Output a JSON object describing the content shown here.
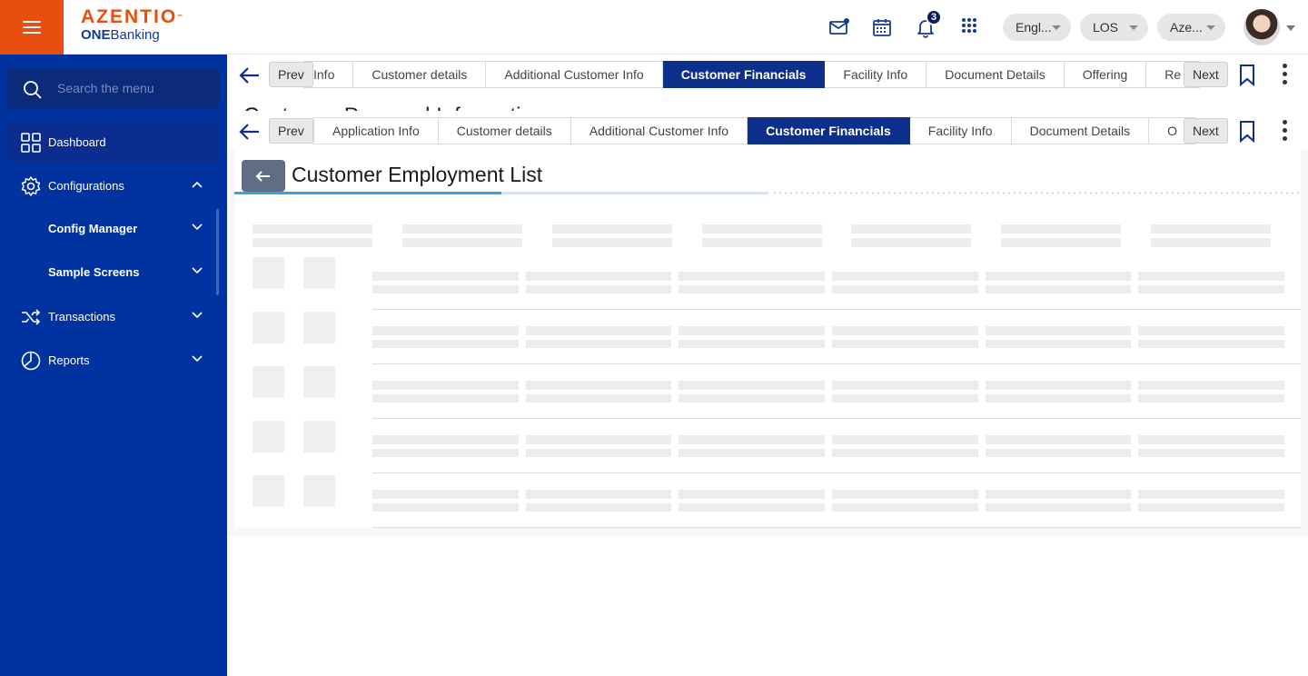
{
  "header": {
    "logo_brand": "AZENTIO",
    "logo_tm": "™",
    "logo_sub_bold": "ONE",
    "logo_sub_rest": "Banking",
    "notification_count": "3",
    "language": "Engl...",
    "module": "LOS",
    "entity": "Aze...",
    "icons": [
      "hamburger-icon",
      "mail-icon",
      "calendar-icon",
      "bell-icon",
      "apps-grid-icon"
    ]
  },
  "sidebar": {
    "search_placeholder": "Search the menu",
    "items": [
      {
        "label": "Dashboard",
        "icon": "dashboard-icon"
      },
      {
        "label": "Configurations",
        "icon": "gear-icon"
      },
      {
        "label": "Config Manager"
      },
      {
        "label": "Sample Screens"
      },
      {
        "label": "Transactions",
        "icon": "shuffle-icon"
      },
      {
        "label": "Reports",
        "icon": "pie-chart-icon"
      }
    ]
  },
  "tabstrip_top": {
    "prev": "Prev",
    "next": "Next",
    "tabs": [
      "Info",
      "Customer details",
      "Additional Customer Info",
      "Customer Financials",
      "Facility Info",
      "Document Details",
      "Offering",
      "Re"
    ],
    "active": "Customer Financials"
  },
  "ghost_title": "Customer Personal Information",
  "tabstrip_bottom": {
    "prev": "Prev",
    "next": "Next",
    "tabs": [
      "Application Info",
      "Customer details",
      "Additional Customer Info",
      "Customer Financials",
      "Facility Info",
      "Document Details",
      "O"
    ],
    "active": "Customer Financials"
  },
  "page": {
    "title": "Customer Employment List",
    "progress": 0.5
  },
  "colors": {
    "accent_orange": "#e84e0f",
    "sidebar_blue": "#0033a0",
    "active_tab": "#0b2f8a"
  }
}
